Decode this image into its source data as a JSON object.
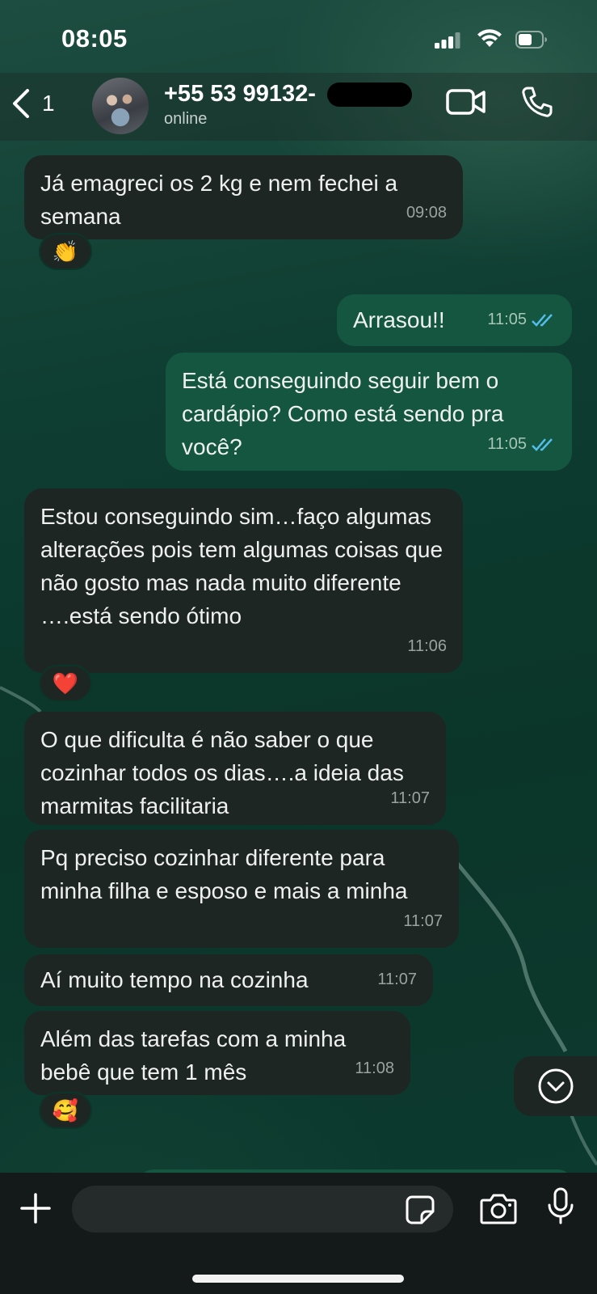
{
  "status_bar": {
    "time": "08:05"
  },
  "header": {
    "back_count": "1",
    "contact_name": "+55 53 99132-",
    "contact_status": "online"
  },
  "messages": [
    {
      "direction": "in",
      "text": "Já emagreci os 2 kg e nem fechei a semana",
      "time": "09:08",
      "reaction": "👏"
    },
    {
      "direction": "out",
      "text": "Arrasou!!",
      "time": "11:05",
      "read": true
    },
    {
      "direction": "out",
      "text": "Está conseguindo seguir bem o cardápio? Como está sendo pra você?",
      "time": "11:05",
      "read": true
    },
    {
      "direction": "in",
      "text": "Estou conseguindo sim…faço algumas alterações pois tem algumas coisas que não gosto mas nada muito diferente ….está sendo ótimo",
      "time": "11:06",
      "reaction": "❤️"
    },
    {
      "direction": "in",
      "text": "O que dificulta é não saber o que cozinhar todos os dias….a ideia das marmitas facilitaria",
      "time": "11:07"
    },
    {
      "direction": "in",
      "text": "Pq preciso cozinhar diferente para minha filha e esposo e mais a minha",
      "time": "11:07"
    },
    {
      "direction": "in",
      "text": "Aí muito tempo na cozinha",
      "time": "11:07"
    },
    {
      "direction": "in",
      "text": "Além das tarefas com a minha bebê que tem 1 mês",
      "time": "11:08",
      "reaction": "🥰"
    }
  ],
  "input": {
    "value": "",
    "placeholder": ""
  },
  "icons": {
    "back": "chevron-left-icon",
    "video": "video-camera-icon",
    "call": "phone-icon",
    "scroll_down": "chevron-down-circle-icon",
    "plus": "plus-icon",
    "sticker": "sticker-icon",
    "camera": "camera-icon",
    "mic": "microphone-icon",
    "read": "double-check-icon"
  },
  "colors": {
    "incoming_bubble": "#1e2624",
    "outgoing_bubble": "#14563f",
    "read_ticks": "#53bdeb"
  }
}
